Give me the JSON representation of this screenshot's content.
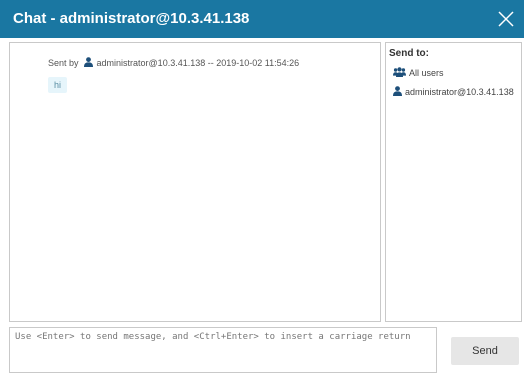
{
  "window": {
    "title": "Chat - administrator@10.3.41.138",
    "title_bar_color": "#1a77a2",
    "close_icon": "close-icon"
  },
  "chat": {
    "messages": [
      {
        "sent_by_label": "Sent by",
        "sender": "administrator@10.3.41.138",
        "separator": "--",
        "timestamp": "2019-10-02 11:54:26",
        "text": "hi",
        "bubble_color": "#e6f5fb"
      }
    ]
  },
  "send_to": {
    "label": "Send to:",
    "recipients": [
      {
        "icon": "users-group-icon",
        "label": "All users"
      },
      {
        "icon": "user-icon",
        "label": "administrator@10.3.41.138"
      }
    ]
  },
  "composer": {
    "placeholder": "Use <Enter> to send message, and <Ctrl+Enter> to insert a carriage return",
    "value": "",
    "send_label": "Send"
  }
}
